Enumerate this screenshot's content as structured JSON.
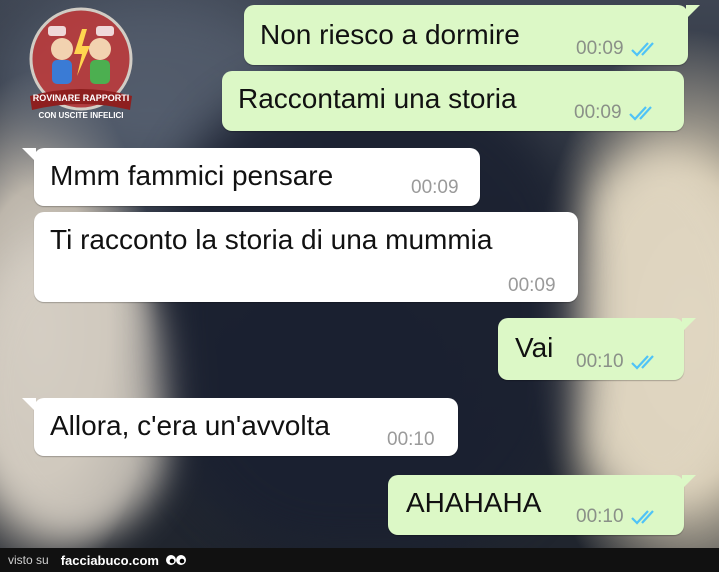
{
  "watermark": {
    "line1": "ROVINARE RAPPORTI",
    "line2": "CON USCITE INFELICI"
  },
  "messages": [
    {
      "direction": "out",
      "text": "Non riesco a dormire",
      "time": "00:09",
      "status": "read"
    },
    {
      "direction": "out",
      "text": "Raccontami una storia",
      "time": "00:09",
      "status": "read"
    },
    {
      "direction": "in",
      "text": "Mmm fammici pensare",
      "time": "00:09"
    },
    {
      "direction": "in",
      "text": "Ti racconto la storia di una mummia",
      "time": "00:09"
    },
    {
      "direction": "out",
      "text": "Vai",
      "time": "00:10",
      "status": "read"
    },
    {
      "direction": "in",
      "text": "Allora, c'era un'avvolta",
      "time": "00:10"
    },
    {
      "direction": "out",
      "text": "AHAHAHA",
      "time": "00:10",
      "status": "read"
    }
  ],
  "footer": {
    "visto_su": "visto su",
    "site": "facciabuco.com"
  },
  "colors": {
    "outgoing_bubble": "#dcf8c6",
    "incoming_bubble": "#ffffff",
    "read_tick": "#4fc3f7"
  }
}
